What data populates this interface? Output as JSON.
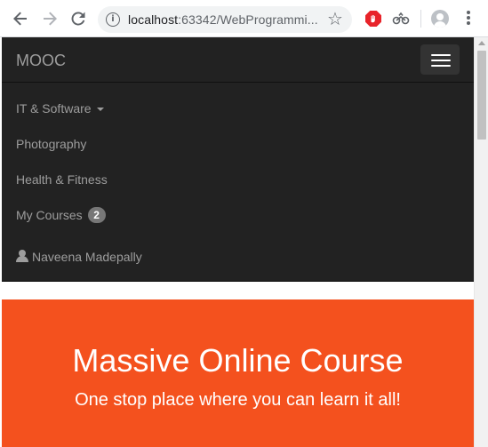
{
  "browser": {
    "url_host": "localhost",
    "url_path": ":63342/WebProgrammi...",
    "back_icon": "back-arrow-icon",
    "forward_icon": "forward-arrow-icon",
    "reload_icon": "reload-icon",
    "info_icon": "info-icon",
    "info_glyph": "i",
    "star_icon": "star-icon",
    "star_glyph": "☆",
    "extensions": [
      "adblock-extension-icon",
      "extension-icon"
    ],
    "profile_icon": "profile-avatar-icon",
    "menu_icon": "kebab-menu-icon"
  },
  "navbar": {
    "brand": "MOOC",
    "toggle_icon": "hamburger-menu-icon",
    "items": [
      {
        "label": "IT & Software",
        "has_dropdown": true
      },
      {
        "label": "Photography"
      },
      {
        "label": "Health & Fitness"
      },
      {
        "label": "My Courses",
        "badge": "2"
      },
      {
        "label": "Naveena Madepally",
        "icon": "user-icon"
      }
    ],
    "colors": {
      "background": "#222222",
      "text": "#9d9d9d",
      "badge": "#777777"
    }
  },
  "hero": {
    "title": "Massive Online Course",
    "subtitle": "One stop place where you can learn it all!",
    "background": "#f4511e"
  }
}
